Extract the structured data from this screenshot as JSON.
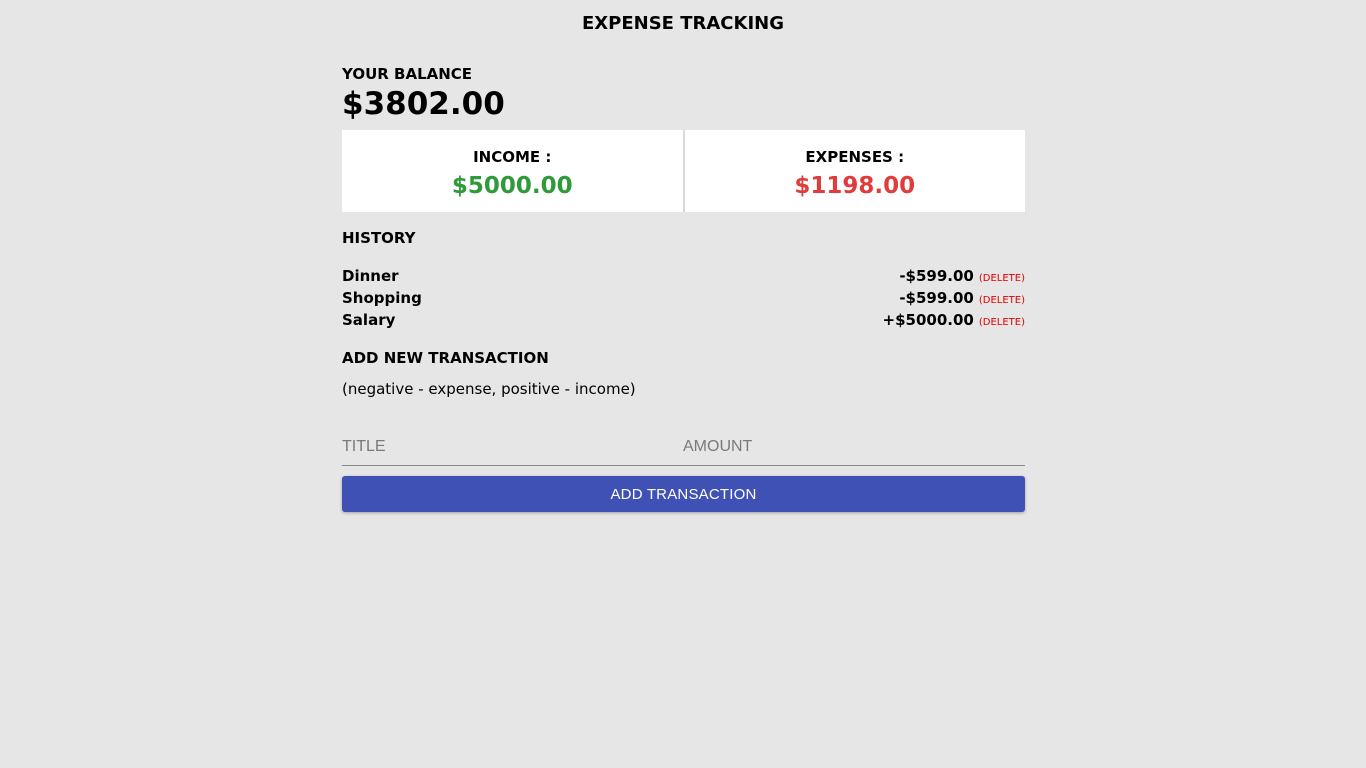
{
  "app": {
    "title": "EXPENSE TRACKING"
  },
  "balance": {
    "label": "YOUR BALANCE",
    "value": "$3802.00"
  },
  "summary": {
    "income_label": "INCOME :",
    "income_value": "$5000.00",
    "expenses_label": "EXPENSES :",
    "expenses_value": "$1198.00",
    "income_color": "#2e9a3a",
    "expense_color": "#e03c3c"
  },
  "history": {
    "heading": "HISTORY",
    "items": [
      {
        "title": "Dinner",
        "amount": "-$599.00",
        "delete_label": "(DELETE)"
      },
      {
        "title": "Shopping",
        "amount": "-$599.00",
        "delete_label": "(DELETE)"
      },
      {
        "title": "Salary",
        "amount": "+$5000.00",
        "delete_label": "(DELETE)"
      }
    ]
  },
  "add_transaction": {
    "heading": "ADD NEW TRANSACTION",
    "hint": "(negative - expense, positive - income)",
    "title_placeholder": "TITLE",
    "title_value": "",
    "amount_placeholder": "AMOUNT",
    "amount_value": "",
    "button_label": "ADD TRANSACTION",
    "button_color": "#3f51b5"
  }
}
